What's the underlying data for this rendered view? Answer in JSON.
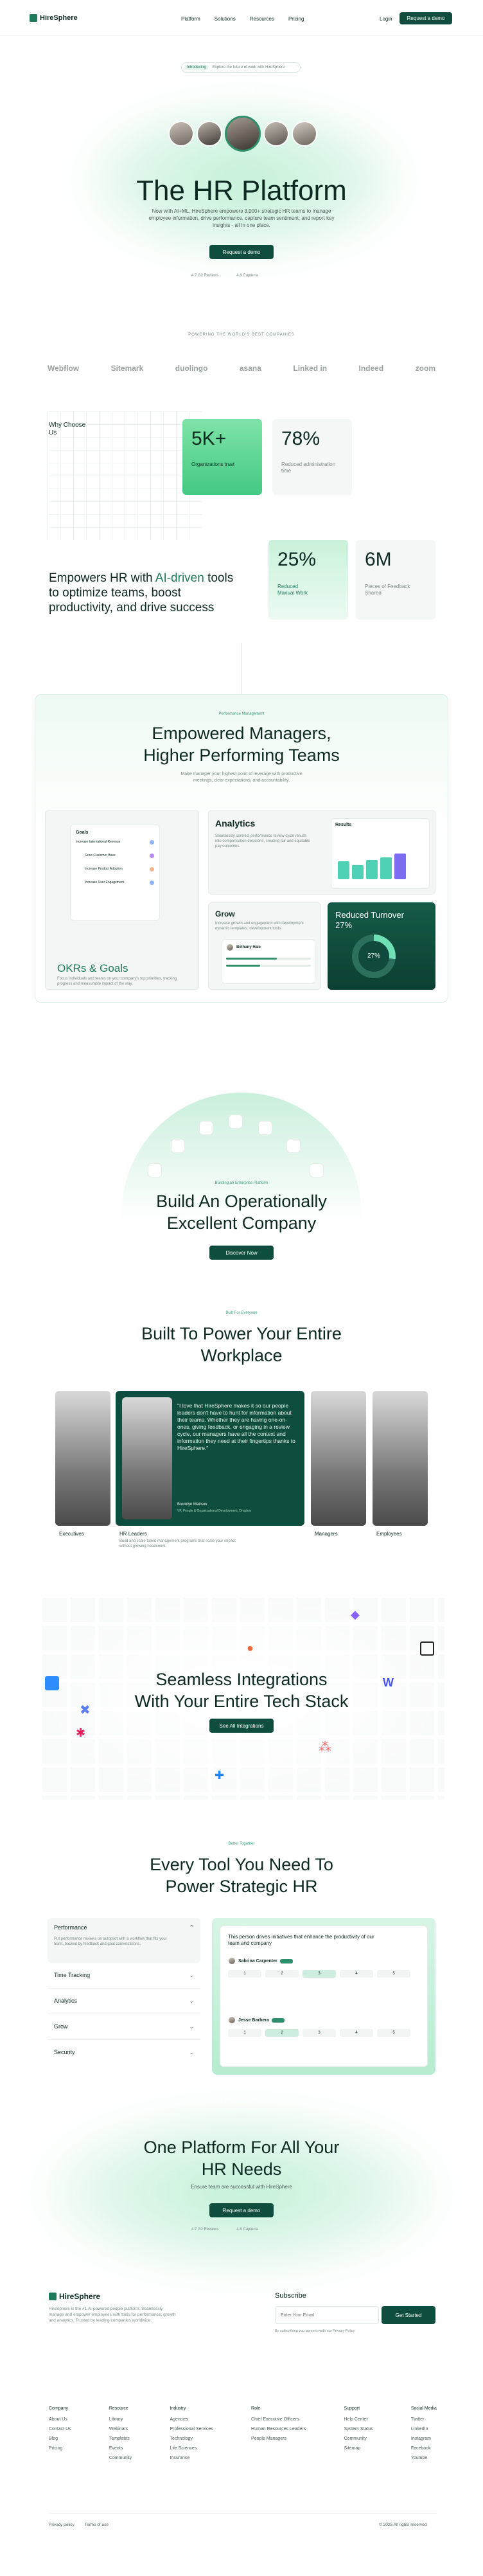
{
  "brand": "HireSphere",
  "nav": {
    "items": [
      "Platform",
      "Solutions",
      "Resources",
      "Pricing"
    ],
    "login": "Login",
    "cta": "Request a demo"
  },
  "hero": {
    "badge_new": "Introducing",
    "badge_text": "Explore the future of work with HireSphere",
    "title": "The HR Platform",
    "subtitle": "Now with AI+ML, HireSphere empowers 3,000+ strategic HR teams to manage employee information, drive performance, capture team sentiment, and report key insights - all in one place.",
    "cta": "Request a demo",
    "rating1": "4.7 G2 Reviews",
    "rating2": "4.8 Capterra"
  },
  "logos": {
    "caption": "POWERING THE WORLD'S BEST COMPANIES",
    "items": [
      "Webflow",
      "Sitemark",
      "duolingo",
      "asana",
      "Linked in",
      "Indeed",
      "zoom"
    ]
  },
  "why": {
    "label": "Why Choose Us",
    "stat1_value": "5K+",
    "stat1_label": "Organizations trust",
    "stat2_value": "78%",
    "stat2_label": "Reduced administration time",
    "stat3_value": "25%",
    "stat3_label": "Reduced Manual Work",
    "stat4_value": "6M",
    "stat4_label": "Pieces of Feedback Shared",
    "headline_a": "Empowers HR with ",
    "headline_b": "AI-driven",
    "headline_c": " tools to optimize teams, boost productivity, and drive success"
  },
  "managers": {
    "tag": "Performance Management",
    "title_1": "Empowered Managers,",
    "title_2": "Higher Performing Teams",
    "subtitle": "Make manager your highest point of leverage with productive meetings, clear expectations, and accountability.",
    "okr_title": "OKRs & Goals",
    "okr_text": "Focus individuals and teams on your company's top priorities, tracking progress and measurable impact of the way.",
    "goals_label": "Goals",
    "goals_items": [
      "Increase International Revenue",
      "Grow Customer Base",
      "Increase Product Adoption",
      "Increase User Engagement"
    ],
    "analytics_title": "Analytics",
    "analytics_text": "Seamlessly connect performance review cycle results into compensation decisions, creating fair and equitable pay outcomes.",
    "results_label": "Results",
    "grow_title": "Grow",
    "grow_text": "Increase growth and engagement with development dynamic templates, development tools.",
    "grow_person": "Bethany Hale",
    "turnover_title": "Reduced Turnover 27%",
    "turnover_value": "27%"
  },
  "operational": {
    "tag": "Building an Enterprise Platform",
    "title_1": "Build An Operationally",
    "title_2": "Excellent Company",
    "cta": "Discover Now"
  },
  "workplace": {
    "tag": "Built For Everyone",
    "title_1": "Built To Power Your Entire",
    "title_2": "Workplace",
    "quote": "\"I love that HireSphere makes it so our people leaders don't have to hunt for information about their teams. Whether they are having one-on-ones, giving feedback, or engaging in a review cycle, our managers have all the context and information they need at their fingertips thanks to HireSphere.\"",
    "quote_author": "Brooklyn Mattson",
    "quote_role": "VP, People & Organizational Development, Dropbox",
    "caption_executives": "Executives",
    "caption_hr": "HR Leaders",
    "caption_hr_text": "Build and scale talent management programs that scale your impact without growing headcount.",
    "caption_managers": "Managers",
    "caption_employees": "Employees"
  },
  "integrations": {
    "title_1": "Seamless Integrations",
    "title_2": "With Your Entire Tech Stack",
    "cta": "See All Integrations"
  },
  "tools": {
    "tag": "Better Together",
    "title_1": "Every Tool You Need To",
    "title_2": "Power Strategic HR",
    "accordion": [
      {
        "label": "Performance",
        "text": "Put performance reviews on autopilot with a workflow that fits your team, backed by feedback and goal conversations."
      },
      {
        "label": "Time Tracking"
      },
      {
        "label": "Analytics"
      },
      {
        "label": "Grow"
      },
      {
        "label": "Security"
      }
    ],
    "panel_text": "This person drives initiatives that enhance the productivity of our team and company",
    "person1": "Sabrina Carpenter",
    "person2": "Jesse Barbera",
    "scale": [
      "1",
      "2",
      "3",
      "4",
      "5"
    ]
  },
  "final_cta": {
    "title_1": "One Platform For All Your",
    "title_2": "HR Needs",
    "subtitle": "Ensure team are successful with HireSphere",
    "cta": "Request a demo",
    "rating1": "4.7 G2 Reviews",
    "rating2": "4.8 Capterra"
  },
  "footer": {
    "about": "HireSphere is the #1 AI-powered people platform. Seamlessly manage and empower employees with tools for performance, growth and analytics. Trusted by leading companies worldwide.",
    "subscribe_title": "Subscribe",
    "email_placeholder": "Enter Your Email",
    "subscribe_cta": "Get Started",
    "subscribe_note": "By subscribing you agree to with our Privacy Policy",
    "columns": [
      {
        "head": "Company",
        "items": [
          "About Us",
          "Contact Us",
          "Blog",
          "Pricing"
        ]
      },
      {
        "head": "Resource",
        "items": [
          "Library",
          "Webinars",
          "Templates",
          "Events",
          "Community"
        ]
      },
      {
        "head": "Industry",
        "items": [
          "Agencies",
          "Professional Services",
          "Technology",
          "Life Sciences",
          "Insurance"
        ]
      },
      {
        "head": "Role",
        "items": [
          "Chief Executive Officers",
          "Human Resources Leaders",
          "People Managers"
        ]
      },
      {
        "head": "Support",
        "items": [
          "Help Center",
          "System Status",
          "Community",
          "Sitemap"
        ]
      },
      {
        "head": "Social Media",
        "items": [
          "Twitter",
          "LinkedIn",
          "Instagram",
          "Facebook",
          "Youtube"
        ]
      }
    ],
    "privacy": "Privacy policy",
    "terms": "Terms of use",
    "copyright": "© 2025 All rights reserved"
  }
}
